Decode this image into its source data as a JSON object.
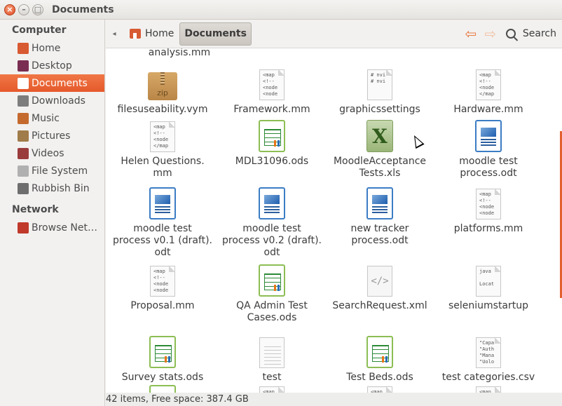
{
  "window": {
    "title": "Documents"
  },
  "sidebar": {
    "sections": [
      {
        "heading": "Computer",
        "items": [
          {
            "label": "Home",
            "icon": "home-folder-icon",
            "color": "#d85a32",
            "active": false
          },
          {
            "label": "Desktop",
            "icon": "desktop-icon",
            "color": "#7a2e52",
            "active": false
          },
          {
            "label": "Documents",
            "icon": "documents-folder-icon",
            "color": "#ffffff",
            "active": true
          },
          {
            "label": "Downloads",
            "icon": "downloads-folder-icon",
            "color": "#7d7d7d",
            "active": false
          },
          {
            "label": "Music",
            "icon": "music-folder-icon",
            "color": "#c46a2e",
            "active": false
          },
          {
            "label": "Pictures",
            "icon": "pictures-folder-icon",
            "color": "#a07c4a",
            "active": false
          },
          {
            "label": "Videos",
            "icon": "videos-folder-icon",
            "color": "#9a3c3c",
            "active": false
          },
          {
            "label": "File System",
            "icon": "drive-icon",
            "color": "#b0b0b0",
            "active": false
          },
          {
            "label": "Rubbish Bin",
            "icon": "trash-icon",
            "color": "#6e6e6e",
            "active": false
          }
        ]
      },
      {
        "heading": "Network",
        "items": [
          {
            "label": "Browse Net…",
            "icon": "network-icon",
            "color": "#c0392b",
            "active": false
          }
        ]
      }
    ]
  },
  "toolbar": {
    "breadcrumbs": [
      {
        "label": "Home"
      },
      {
        "label": "Documents"
      }
    ],
    "search_label": "Search"
  },
  "content": {
    "partial_top_label": "analysis.mm",
    "files": [
      {
        "name": "filesuseability.vym",
        "icon": "zip",
        "lines": [
          "zip"
        ]
      },
      {
        "name": "Framework.mm",
        "icon": "code",
        "lines": [
          "<map",
          "<!--",
          "<node",
          "<node"
        ]
      },
      {
        "name": "graphicssettings",
        "icon": "code",
        "lines": [
          "# nvi",
          "# nvi"
        ]
      },
      {
        "name": "Hardware.mm",
        "icon": "code",
        "lines": [
          "<map",
          "<!--",
          "<node",
          "</map"
        ]
      },
      {
        "name": "Helen Questions.\nmm",
        "icon": "code",
        "lines": [
          "<map",
          "<!--",
          "<node",
          "</map"
        ]
      },
      {
        "name": "MDL31096.ods",
        "icon": "ods"
      },
      {
        "name": "MoodleAcceptance\nTests.xls",
        "icon": "xls",
        "glyph": "X"
      },
      {
        "name": "moodle test\nprocess.odt",
        "icon": "odt"
      },
      {
        "name": "moodle test\nprocess v0.1 (draft).\nodt",
        "icon": "odt"
      },
      {
        "name": "moodle test\nprocess v0.2 (draft).\nodt",
        "icon": "odt"
      },
      {
        "name": "new tracker\nprocess.odt",
        "icon": "odt"
      },
      {
        "name": "platforms.mm",
        "icon": "code",
        "lines": [
          "<map",
          "<!--",
          "<node",
          "<node"
        ]
      },
      {
        "name": "Proposal.mm",
        "icon": "code",
        "lines": [
          "<map",
          "<!--",
          "<node",
          "<node"
        ]
      },
      {
        "name": "QA Admin Test\nCases.ods",
        "icon": "ods"
      },
      {
        "name": "SearchRequest.xml",
        "icon": "xml",
        "glyph": "</>"
      },
      {
        "name": "seleniumstartup",
        "icon": "code",
        "lines": [
          "java",
          "",
          "Locat"
        ]
      },
      {
        "name": "Survey stats.ods",
        "icon": "ods"
      },
      {
        "name": "test",
        "icon": "lines"
      },
      {
        "name": "Test Beds.ods",
        "icon": "ods"
      },
      {
        "name": "test categories.csv",
        "icon": "code",
        "lines": [
          "\"Capa",
          "\"Auth",
          "\"Mana",
          "\"Uolo"
        ]
      },
      {
        "name": "",
        "icon": "ods"
      },
      {
        "name": "",
        "icon": "code",
        "lines": [
          "<map"
        ]
      },
      {
        "name": "",
        "icon": "code",
        "lines": [
          "<map"
        ]
      },
      {
        "name": "",
        "icon": "code",
        "lines": [
          "<map"
        ]
      }
    ]
  },
  "statusbar": {
    "text": "42 items, Free space: 387.4 GB"
  },
  "colors": {
    "accent": "#e5592b",
    "selection": "#f07746"
  }
}
